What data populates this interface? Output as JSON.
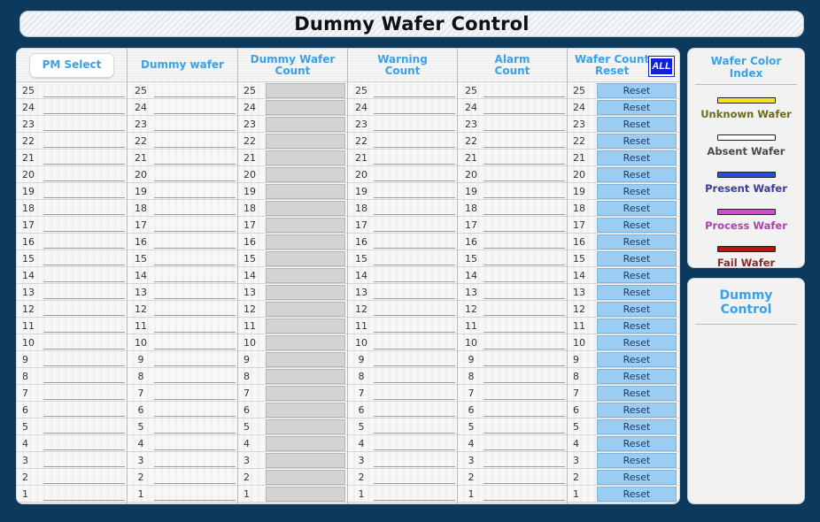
{
  "title": "Dummy Wafer Control",
  "table": {
    "headers": {
      "pm_select": "PM Select",
      "dummy_wafer": "Dummy wafer",
      "dummy_wafer_count_1": "Dummy Wafer",
      "dummy_wafer_count_2": "Count",
      "warning_count_1": "Warning",
      "warning_count_2": "Count",
      "alarm_count_1": "Alarm",
      "alarm_count_2": "Count",
      "wafer_count_reset_1": "Wafer Count",
      "wafer_count_reset_2": "Reset",
      "all_button": "ALL"
    },
    "reset_label": "Reset",
    "rows": [
      "25",
      "24",
      "23",
      "22",
      "21",
      "20",
      "19",
      "18",
      "17",
      "16",
      "15",
      "14",
      "13",
      "12",
      "11",
      "10",
      "9",
      "8",
      "7",
      "6",
      "5",
      "4",
      "3",
      "2",
      "1"
    ]
  },
  "legend": {
    "title_1": "Wafer Color",
    "title_2": "Index",
    "items": [
      {
        "label": "Unknown Wafer",
        "bar_color": "#f5e21a",
        "text_color": "#6b6b1a"
      },
      {
        "label": "Absent Wafer",
        "bar_color": "#ffffff",
        "text_color": "#4a4a4a"
      },
      {
        "label": "Present Wafer",
        "bar_color": "#1f4fe0",
        "text_color": "#3b3b9e"
      },
      {
        "label": "Process Wafer",
        "bar_color": "#e040e0",
        "text_color": "#b040b0"
      },
      {
        "label": "Fail Wafer",
        "bar_color": "#c01010",
        "text_color": "#8b2a2a"
      }
    ]
  },
  "dummy_control": {
    "title": "Dummy Control"
  },
  "colors": {
    "background": "#0d3a5c",
    "header_text": "#3ba1e6",
    "reset_button": "#9bcdf3",
    "all_button": "#1020e0"
  }
}
